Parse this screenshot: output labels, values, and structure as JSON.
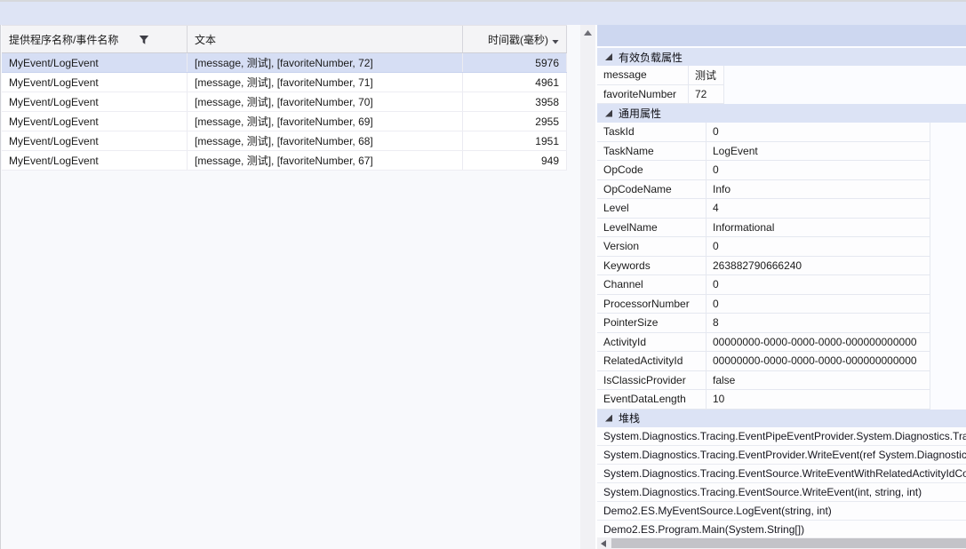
{
  "colors": {
    "top_band": "#dee4f5",
    "selection": "#d6def4",
    "details_header_band": "#cdd7f0",
    "section_header": "#dce3f5",
    "scrollbar_thumb": "#c3c3c8"
  },
  "icons": {
    "filter": "filter-funnel-icon",
    "sort": "sort-descending-icon",
    "expander": "section-expanded-icon",
    "scroll_up": "scroll-up-icon",
    "scroll_left": "scroll-left-icon"
  },
  "events_table": {
    "columns": [
      {
        "label": "提供程序名称/事件名称"
      },
      {
        "label": "文本"
      },
      {
        "label": "时间戳(毫秒)",
        "sort": "desc"
      }
    ],
    "rows": [
      {
        "provider": "MyEvent/LogEvent",
        "text": "[message, 测试], [favoriteNumber, 72]",
        "timestamp": "5976",
        "selected": true
      },
      {
        "provider": "MyEvent/LogEvent",
        "text": "[message, 测试], [favoriteNumber, 71]",
        "timestamp": "4961",
        "selected": false
      },
      {
        "provider": "MyEvent/LogEvent",
        "text": "[message, 测试], [favoriteNumber, 70]",
        "timestamp": "3958",
        "selected": false
      },
      {
        "provider": "MyEvent/LogEvent",
        "text": "[message, 测试], [favoriteNumber, 69]",
        "timestamp": "2955",
        "selected": false
      },
      {
        "provider": "MyEvent/LogEvent",
        "text": "[message, 测试], [favoriteNumber, 68]",
        "timestamp": "1951",
        "selected": false
      },
      {
        "provider": "MyEvent/LogEvent",
        "text": "[message, 测试], [favoriteNumber, 67]",
        "timestamp": "949",
        "selected": false
      }
    ]
  },
  "details": {
    "payload": {
      "title": "有效负载属性",
      "rows": [
        {
          "name": "message",
          "value": "测试"
        },
        {
          "name": "favoriteNumber",
          "value": "72"
        }
      ]
    },
    "common": {
      "title": "通用属性",
      "rows": [
        {
          "name": "TaskId",
          "value": "0"
        },
        {
          "name": "TaskName",
          "value": "LogEvent"
        },
        {
          "name": "OpCode",
          "value": "0"
        },
        {
          "name": "OpCodeName",
          "value": "Info"
        },
        {
          "name": "Level",
          "value": "4"
        },
        {
          "name": "LevelName",
          "value": "Informational"
        },
        {
          "name": "Version",
          "value": "0"
        },
        {
          "name": "Keywords",
          "value": "263882790666240"
        },
        {
          "name": "Channel",
          "value": "0"
        },
        {
          "name": "ProcessorNumber",
          "value": "0"
        },
        {
          "name": "PointerSize",
          "value": "8"
        },
        {
          "name": "ActivityId",
          "value": "00000000-0000-0000-0000-000000000000"
        },
        {
          "name": "RelatedActivityId",
          "value": "00000000-0000-0000-0000-000000000000"
        },
        {
          "name": "IsClassicProvider",
          "value": "false"
        },
        {
          "name": "EventDataLength",
          "value": "10"
        }
      ]
    },
    "stack": {
      "title": "堆栈",
      "frames": [
        "System.Diagnostics.Tracing.EventPipeEventProvider.System.Diagnostics.Tracing.IEventProvider.EventWriteTransfer",
        "System.Diagnostics.Tracing.EventProvider.WriteEvent(ref System.Diagnostics.Tracing.EventDescriptor",
        "System.Diagnostics.Tracing.EventSource.WriteEventWithRelatedActivityIdCore(int, System.Guid*",
        "System.Diagnostics.Tracing.EventSource.WriteEvent(int, string, int)",
        "Demo2.ES.MyEventSource.LogEvent(string, int)",
        "Demo2.ES.Program.Main(System.String[])"
      ]
    }
  }
}
